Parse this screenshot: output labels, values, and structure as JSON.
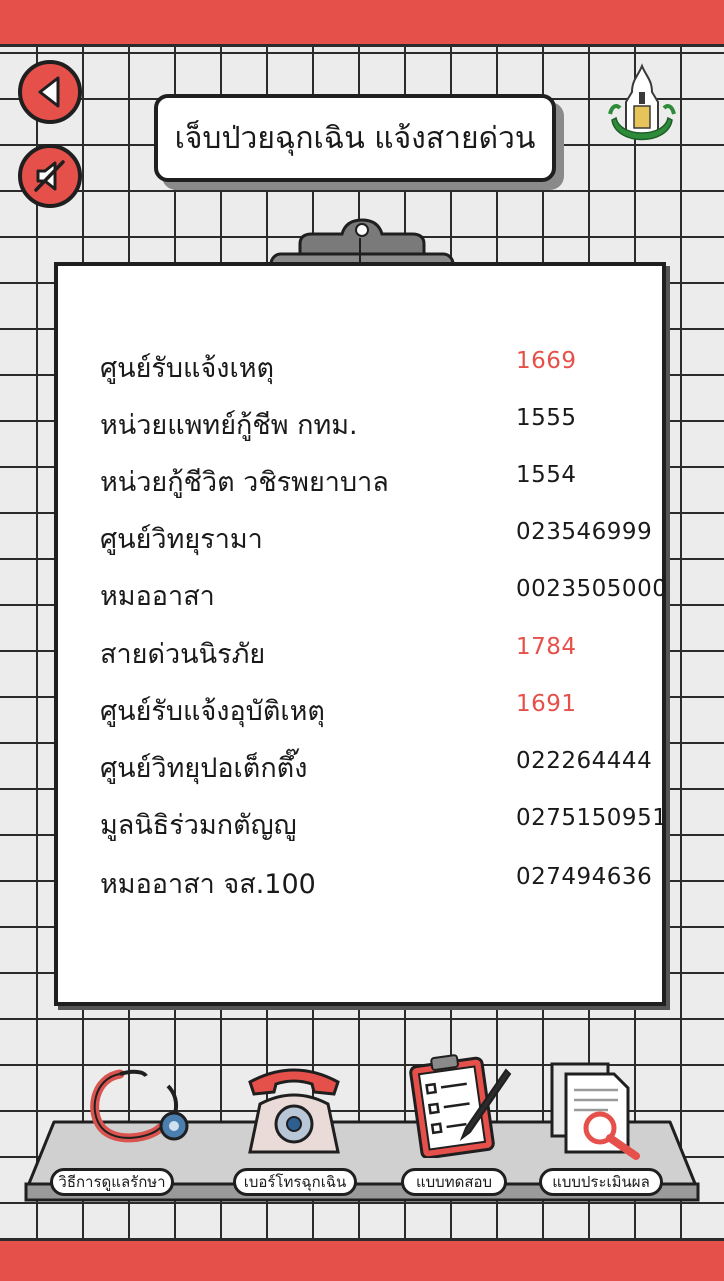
{
  "header": {
    "title": "เจ็บป่วยฉุกเฉิน แจ้งสายด่วน",
    "back_icon": "back-arrow-icon",
    "mute_icon": "speaker-mute-icon",
    "logo_icon": "faculty-seal-logo"
  },
  "colors": {
    "accent": "#e5504b",
    "ink": "#1f1f1f",
    "paper": "#ffffff",
    "grid_bg": "#ececec"
  },
  "contacts": [
    {
      "name": "ศูนย์รับแจ้งเหตุ",
      "number": "1669",
      "highlight": true
    },
    {
      "name": "หน่วยแพทย์กู้ชีพ กทม.",
      "number": "1555",
      "highlight": false
    },
    {
      "name": "หน่วยกู้ชีวิต วชิรพยาบาล",
      "number": "1554",
      "highlight": false
    },
    {
      "name": "ศูนย์วิทยุรามา",
      "number": "023546999",
      "highlight": false
    },
    {
      "name": "หมออาสา",
      "number": "0023505000",
      "highlight": false
    },
    {
      "name": "สายด่วนนิรภัย",
      "number": "1784",
      "highlight": true
    },
    {
      "name": "ศูนย์รับแจ้งอุบัติเหตุ",
      "number": "1691",
      "highlight": true
    },
    {
      "name": "ศูนย์วิทยุปอเต็กตึ๊ง",
      "number": "022264444",
      "highlight": false
    },
    {
      "name": "มูลนิธิร่วมกตัญญู",
      "number": "0275150951",
      "highlight": false
    },
    {
      "name": "หมออาสา จส.100",
      "number": "027494636",
      "highlight": false
    }
  ],
  "bottom_nav": [
    {
      "label": "วิธีการดูแลรักษา",
      "icon": "stethoscope-icon"
    },
    {
      "label": "เบอร์โทรฉุกเฉิน",
      "icon": "telephone-icon"
    },
    {
      "label": "แบบทดสอบ",
      "icon": "checklist-clipboard-icon"
    },
    {
      "label": "แบบประเมินผล",
      "icon": "document-magnifier-icon"
    }
  ]
}
